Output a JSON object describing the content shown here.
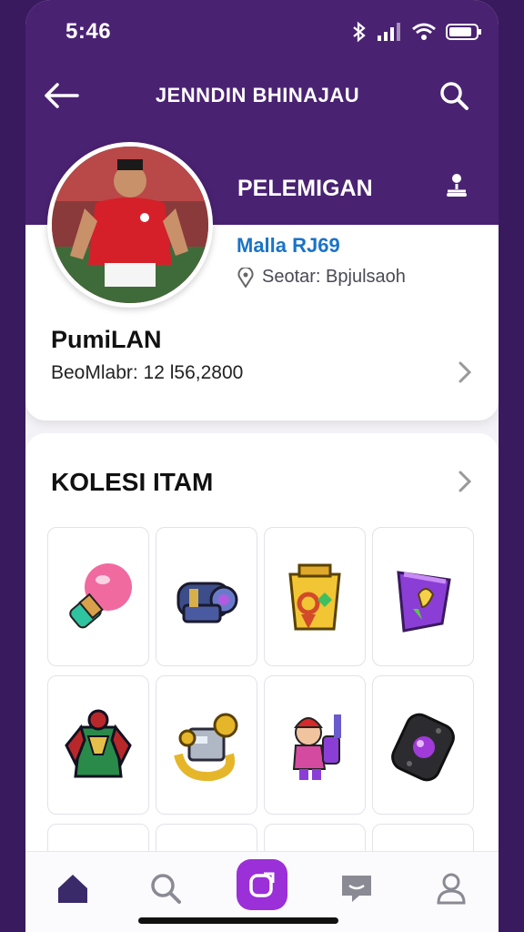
{
  "status_bar": {
    "time": "5:46"
  },
  "header": {
    "title": "JENNDIN BHINAJAU",
    "back_icon": "arrow-left-icon",
    "search_icon": "search-icon"
  },
  "profile": {
    "banner_label": "PELEMIGAN",
    "handle": "Malla RJ69",
    "location": "Seotar: Bpjulsaoh",
    "name": "PumiLAN",
    "stat": "BeoMlabr: 12 l56,2800"
  },
  "collection": {
    "title": "KOLESI ITAM",
    "items": [
      {
        "icon": "potion-bulb-icon"
      },
      {
        "icon": "cannon-icon"
      },
      {
        "icon": "treasure-box-icon"
      },
      {
        "icon": "shield-badge-icon"
      },
      {
        "icon": "armor-icon"
      },
      {
        "icon": "gold-gear-icon"
      },
      {
        "icon": "hero-figure-icon"
      },
      {
        "icon": "gamepad-icon"
      }
    ]
  },
  "bottom_nav": [
    {
      "icon": "home-icon"
    },
    {
      "icon": "search-icon"
    },
    {
      "icon": "create-post-icon"
    },
    {
      "icon": "chat-icon"
    },
    {
      "icon": "profile-icon"
    }
  ],
  "colors": {
    "header_bg": "#4a2272",
    "accent_purple": "#9b2fd8",
    "handle_blue": "#1a73c9"
  }
}
